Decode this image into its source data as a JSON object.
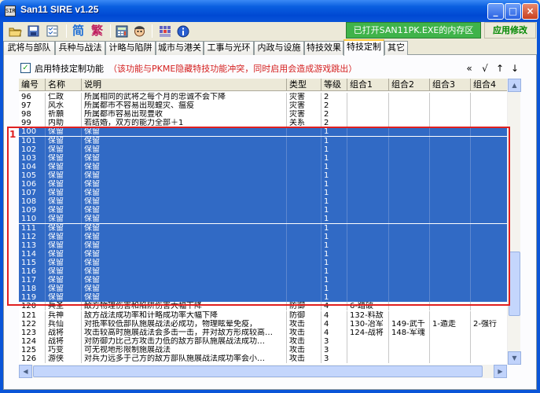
{
  "window": {
    "title": "San11 SIRE v1.25",
    "app_icon_text": "SIR",
    "minimize": "_",
    "maximize": "□",
    "close": "×"
  },
  "toolbar": {
    "icons": [
      "open-folder-icon",
      "save-icon",
      "checklist-icon"
    ],
    "simplified_label": "简",
    "traditional_label": "繁",
    "extra_icons": [
      "calculator-icon",
      "portrait-icon",
      "grid-settings-icon",
      "info-icon"
    ],
    "status": "已打开SAN11PK.EXE的内存区",
    "apply_label": "应用修改"
  },
  "tabs": [
    "武将与部队",
    "兵种与战法",
    "计略与陷阱",
    "城市与港关",
    "工事与光环",
    "内政与设施",
    "特技效果",
    "特技定制",
    "其它"
  ],
  "active_tab": 7,
  "options": {
    "enable_label": "启用特技定制功能",
    "enabled": true,
    "note": "（该功能与PKME隐藏特技功能冲突，同时启用会造成游戏跳出）",
    "nav": [
      "«",
      "√",
      "↑",
      "↓"
    ]
  },
  "table": {
    "columns": [
      "编号",
      "名称",
      "说明",
      "类型",
      "等级",
      "组合1",
      "组合2",
      "组合3",
      "组合4"
    ],
    "rows": [
      [
        "96",
        "仁政",
        "所属相同的武将之每个月的忠诚不会下降",
        "灾害",
        "2",
        "",
        "",
        "",
        ""
      ],
      [
        "97",
        "风水",
        "所属都市不容易出现蝗灾、瘟疫",
        "灾害",
        "2",
        "",
        "",
        "",
        ""
      ],
      [
        "98",
        "祈願",
        "所属都市容易出现豊收",
        "灾害",
        "2",
        "",
        "",
        "",
        ""
      ],
      [
        "99",
        "内助",
        "若结婚，双方的能力全部＋1",
        "关系",
        "2",
        "",
        "",
        "",
        ""
      ],
      [
        "100",
        "保留",
        "保留",
        "",
        "1",
        "",
        "",
        "",
        ""
      ],
      [
        "101",
        "保留",
        "保留",
        "",
        "1",
        "",
        "",
        "",
        ""
      ],
      [
        "102",
        "保留",
        "保留",
        "",
        "1",
        "",
        "",
        "",
        ""
      ],
      [
        "103",
        "保留",
        "保留",
        "",
        "1",
        "",
        "",
        "",
        ""
      ],
      [
        "104",
        "保留",
        "保留",
        "",
        "1",
        "",
        "",
        "",
        ""
      ],
      [
        "105",
        "保留",
        "保留",
        "",
        "1",
        "",
        "",
        "",
        ""
      ],
      [
        "106",
        "保留",
        "保留",
        "",
        "1",
        "",
        "",
        "",
        ""
      ],
      [
        "107",
        "保留",
        "保留",
        "",
        "1",
        "",
        "",
        "",
        ""
      ],
      [
        "108",
        "保留",
        "保留",
        "",
        "1",
        "",
        "",
        "",
        ""
      ],
      [
        "109",
        "保留",
        "保留",
        "",
        "1",
        "",
        "",
        "",
        ""
      ],
      [
        "110",
        "保留",
        "保留",
        "",
        "1",
        "",
        "",
        "",
        ""
      ],
      [
        "111",
        "保留",
        "保留",
        "",
        "1",
        "",
        "",
        "",
        ""
      ],
      [
        "112",
        "保留",
        "保留",
        "",
        "1",
        "",
        "",
        "",
        ""
      ],
      [
        "113",
        "保留",
        "保留",
        "",
        "1",
        "",
        "",
        "",
        ""
      ],
      [
        "114",
        "保留",
        "保留",
        "",
        "1",
        "",
        "",
        "",
        ""
      ],
      [
        "115",
        "保留",
        "保留",
        "",
        "1",
        "",
        "",
        "",
        ""
      ],
      [
        "116",
        "保留",
        "保留",
        "",
        "1",
        "",
        "",
        "",
        ""
      ],
      [
        "117",
        "保留",
        "保留",
        "",
        "1",
        "",
        "",
        "",
        ""
      ],
      [
        "118",
        "保留",
        "保留",
        "",
        "1",
        "",
        "",
        "",
        ""
      ],
      [
        "119",
        "保留",
        "保留",
        "",
        "1",
        "",
        "",
        "",
        ""
      ],
      [
        "120",
        "兵圣",
        "敌方物理伤害和陷阱伤害大幅下降",
        "防御",
        "4",
        "6-踏破",
        "",
        "",
        ""
      ],
      [
        "121",
        "兵神",
        "敌方战法成功率和计略成功率大幅下降",
        "防御",
        "4",
        "132-料敌",
        "",
        "",
        ""
      ],
      [
        "122",
        "兵仙",
        "对抵率较低部队施展战法必成功，物理眩晕免疫，",
        "攻击",
        "4",
        "130-冶军",
        "149-武千",
        "1-遁走",
        "2-强行"
      ],
      [
        "123",
        "战将",
        "攻击较高时施展战法会多击一击，并对敌方形成较高…",
        "攻击",
        "4",
        "124-战将",
        "148-军魂",
        "",
        ""
      ],
      [
        "124",
        "战将",
        "对防御力比己方攻击力低的敌方部队施展战法成功…",
        "攻击",
        "3",
        "",
        "",
        "",
        ""
      ],
      [
        "125",
        "巧变",
        "可无视地形限制施展战法",
        "攻击",
        "3",
        "",
        "",
        "",
        ""
      ],
      [
        "126",
        "游侠",
        "对兵力远多于己方的敌方部队施展战法成功率会小…",
        "攻击",
        "3",
        "",
        "",
        "",
        ""
      ]
    ],
    "selected_from": 4,
    "selected_to": 23,
    "highlight_number": "1"
  }
}
